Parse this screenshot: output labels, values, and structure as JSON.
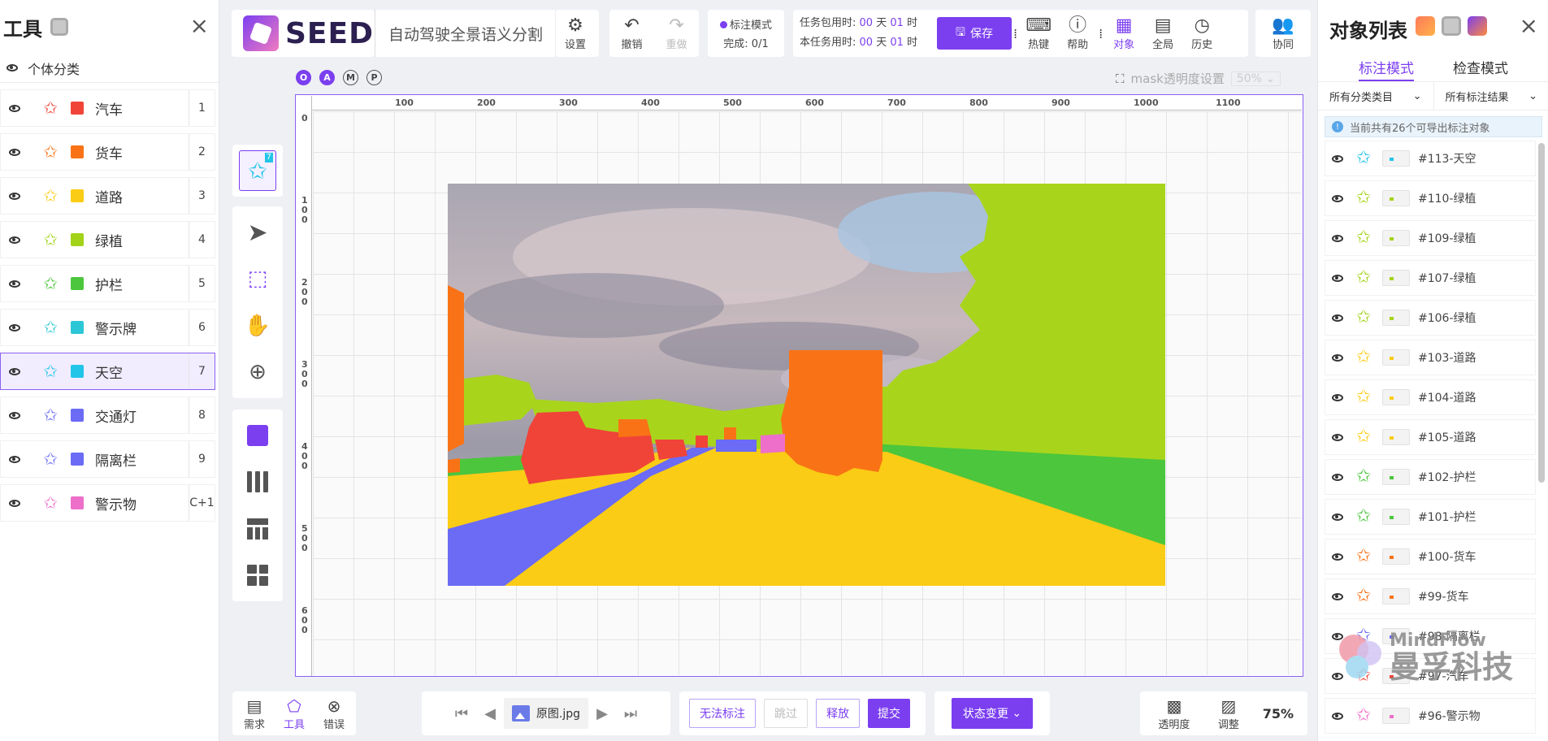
{
  "left_panel": {
    "title": "工具",
    "close": "×",
    "individual_label": "个体分类",
    "categories": [
      {
        "name": "汽车",
        "color": "#f04438",
        "key": "1"
      },
      {
        "name": "货车",
        "color": "#f97316",
        "key": "2"
      },
      {
        "name": "道路",
        "color": "#facc15",
        "key": "3"
      },
      {
        "name": "绿植",
        "color": "#a3d319",
        "key": "4"
      },
      {
        "name": "护栏",
        "color": "#4cc63c",
        "key": "5"
      },
      {
        "name": "警示牌",
        "color": "#2cc7d6",
        "key": "6"
      },
      {
        "name": "天空",
        "color": "#22c5e8",
        "key": "7"
      },
      {
        "name": "交通灯",
        "color": "#6b6bf5",
        "key": "8"
      },
      {
        "name": "隔离栏",
        "color": "#6b6bf5",
        "key": "9"
      },
      {
        "name": "警示物",
        "color": "#ee6fc9",
        "key": "C+1"
      }
    ]
  },
  "header": {
    "brand": "SEED",
    "project_name": "自动驾驶全景语义分割",
    "settings": "设置",
    "undo": "撤销",
    "redo": "重做",
    "mode_label": "标注模式",
    "progress": "完成: 0/1",
    "task_total_time": "任务包用时:",
    "task_time": "本任务用时:",
    "time1": {
      "d": "00",
      "h": "01"
    },
    "time2": {
      "d": "00",
      "h": "01"
    },
    "unit_day": "天",
    "unit_hour": "时",
    "save": "保存",
    "hotkeys": "热键",
    "help": "帮助",
    "objects": "对象",
    "global": "全局",
    "history": "历史",
    "collab": "协同"
  },
  "tool_strip": {
    "badge": "7"
  },
  "canvas": {
    "modes": [
      "O",
      "A",
      "M",
      "P"
    ],
    "mask_label": "mask透明度设置",
    "mask_value": "50%",
    "ruler_x": [
      "100",
      "200",
      "300",
      "400",
      "500",
      "600",
      "700",
      "800",
      "900",
      "1000",
      "1100"
    ],
    "ruler_y": [
      "0",
      "100",
      "200",
      "300",
      "400",
      "500",
      "600"
    ]
  },
  "bottom": {
    "requirements": "需求",
    "tools": "工具",
    "errors": "错误",
    "file_name": "原图.jpg",
    "cannot_label": "无法标注",
    "skip": "跳过",
    "release": "释放",
    "submit": "提交",
    "status_change": "状态变更",
    "opacity": "透明度",
    "adjust": "调整",
    "zoom": "75%"
  },
  "right_panel": {
    "title": "对象列表",
    "close": "×",
    "tab_label": "标注模式",
    "tab_check": "检查模式",
    "filter_category": "所有分类类目",
    "filter_result": "所有标注结果",
    "info": "当前共有26个可导出标注对象",
    "objects": [
      {
        "id": "#113-天空",
        "color": "#22c5e8"
      },
      {
        "id": "#110-绿植",
        "color": "#a3d319"
      },
      {
        "id": "#109-绿植",
        "color": "#a3d319"
      },
      {
        "id": "#107-绿植",
        "color": "#a3d319"
      },
      {
        "id": "#106-绿植",
        "color": "#a3d319"
      },
      {
        "id": "#103-道路",
        "color": "#facc15"
      },
      {
        "id": "#104-道路",
        "color": "#facc15"
      },
      {
        "id": "#105-道路",
        "color": "#facc15"
      },
      {
        "id": "#102-护栏",
        "color": "#4cc63c"
      },
      {
        "id": "#101-护栏",
        "color": "#4cc63c"
      },
      {
        "id": "#100-货车",
        "color": "#f97316"
      },
      {
        "id": "#99-货车",
        "color": "#f97316"
      },
      {
        "id": "#98-隔离栏",
        "color": "#6b6bf5"
      },
      {
        "id": "#97-汽车",
        "color": "#f04438"
      },
      {
        "id": "#96-警示物",
        "color": "#ee6fc9"
      }
    ]
  },
  "watermark": {
    "en": "MindFlow",
    "cn": "曼孚科技"
  }
}
